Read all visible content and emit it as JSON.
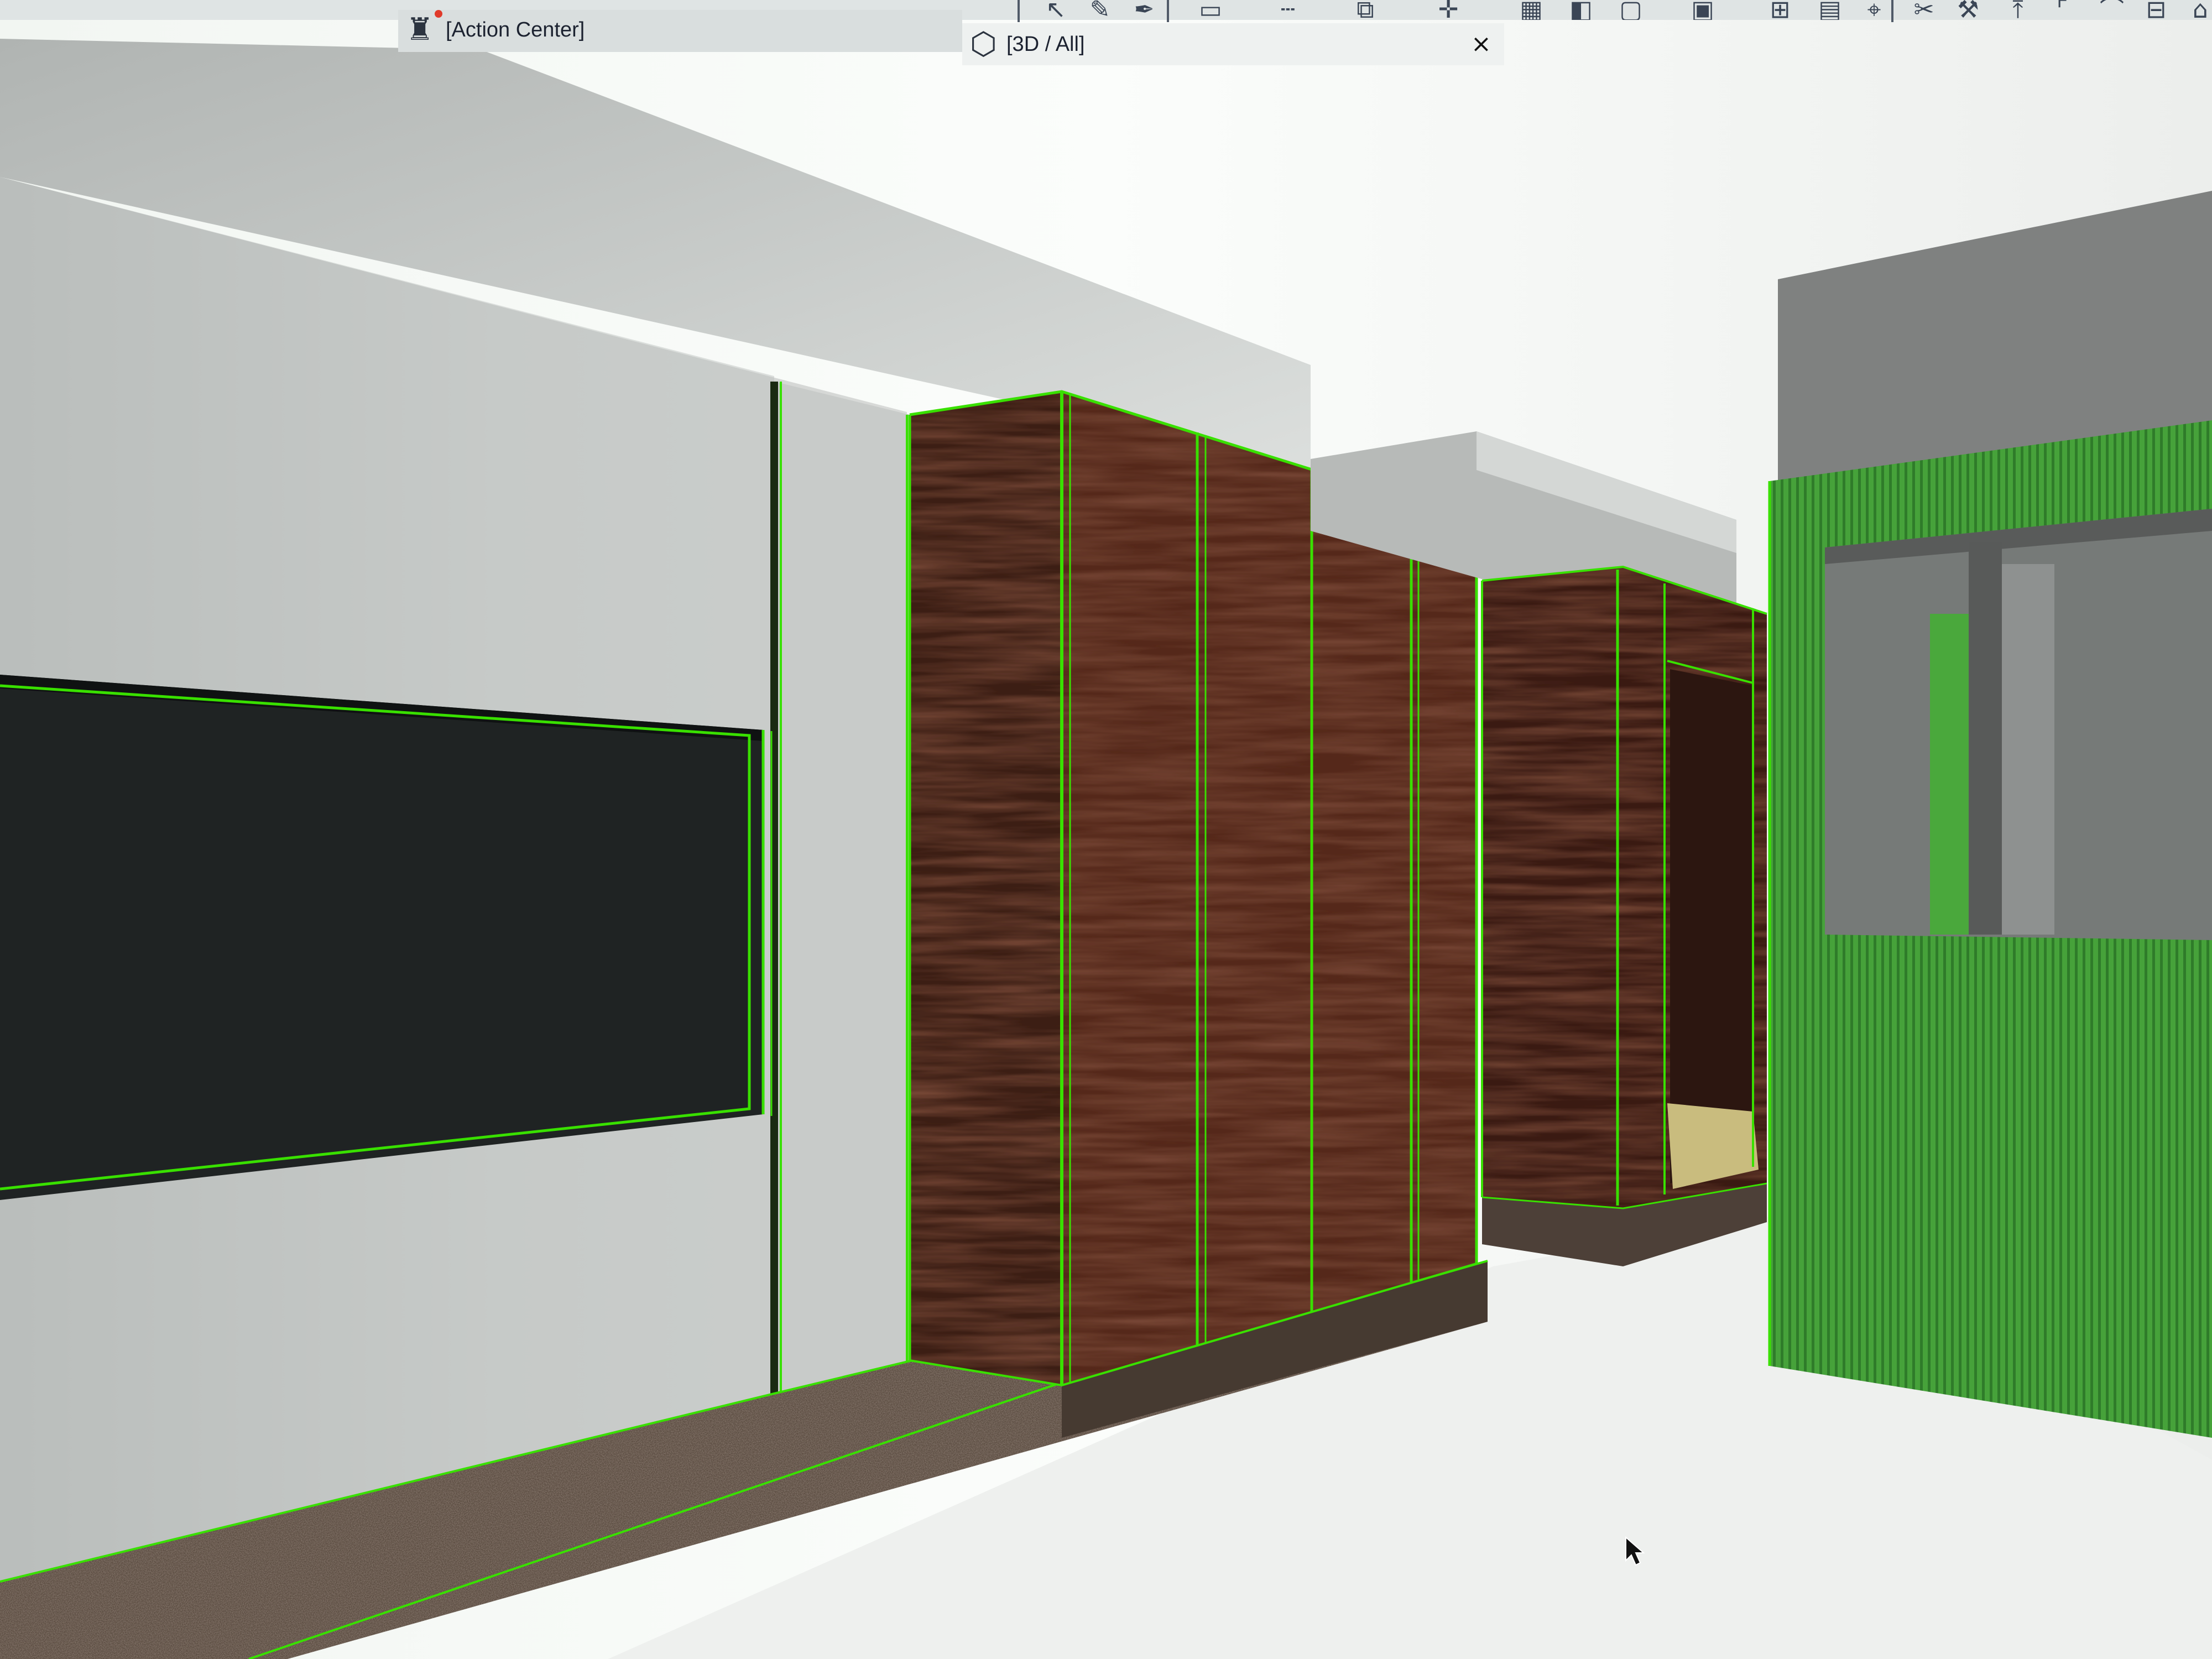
{
  "toolbar": {
    "icons": [
      {
        "name": "select-arrow-icon",
        "glyph": "↖"
      },
      {
        "name": "pencil-icon",
        "glyph": "✎"
      },
      {
        "name": "pen-icon",
        "glyph": "✒"
      },
      {
        "name": "section-icon",
        "glyph": "▭"
      },
      {
        "name": "line-style-icon",
        "glyph": "┄"
      },
      {
        "name": "coordinate-xy-icon",
        "glyph": "⧉"
      },
      {
        "name": "snap-crosshair-icon",
        "glyph": "✛"
      },
      {
        "name": "grid-icon",
        "glyph": "▦"
      },
      {
        "name": "elevation-icon",
        "glyph": "◧"
      },
      {
        "name": "frame-icon",
        "glyph": "▢"
      },
      {
        "name": "layer-icon",
        "glyph": "▣"
      },
      {
        "name": "model-check-icon",
        "glyph": "⊞"
      },
      {
        "name": "table-icon",
        "glyph": "▤"
      },
      {
        "name": "explode-icon",
        "glyph": "⌖"
      },
      {
        "name": "trim-icon",
        "glyph": "✂"
      },
      {
        "name": "adjust-icon",
        "glyph": "⚒"
      },
      {
        "name": "offset-icon",
        "glyph": "⤒"
      },
      {
        "name": "corner-icon",
        "glyph": "⌜"
      },
      {
        "name": "fillet-icon",
        "glyph": "⌒"
      },
      {
        "name": "split-icon",
        "glyph": "⊟"
      },
      {
        "name": "home-icon",
        "glyph": "⌂"
      }
    ]
  },
  "tabs": [
    {
      "label": "[Action Center]",
      "icon": "action-center-icon"
    },
    {
      "label": "[3D / All]",
      "icon": "3d-view-icon"
    }
  ],
  "close_label": "×",
  "colors": {
    "highlight_green": "#39e000",
    "wood_dark": "#4e2417",
    "panel_green": "#3f9a36",
    "wall_grey": "#c2c6c4"
  }
}
